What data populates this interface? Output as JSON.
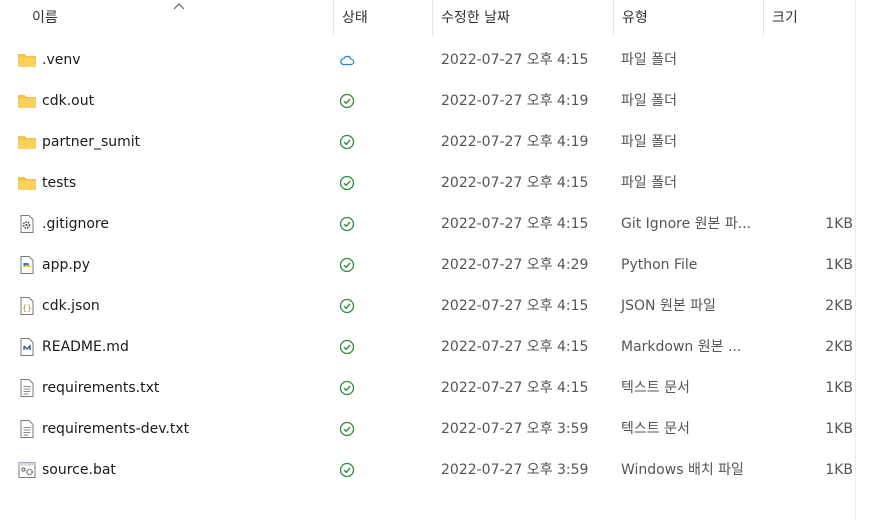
{
  "columns": {
    "name": "이름",
    "status": "상태",
    "date": "수정한 날짜",
    "type": "유형",
    "size": "크기"
  },
  "colors": {
    "folder": "#f8c543",
    "synced": "#2e8b3f",
    "cloud": "#2d7fd4"
  },
  "rows": [
    {
      "name": ".venv",
      "icon": "folder-icon",
      "status": "cloud-icon",
      "date": "2022-07-27 오후 4:15",
      "type": "파일 폴더",
      "size": ""
    },
    {
      "name": "cdk.out",
      "icon": "folder-icon",
      "status": "synced-check-icon",
      "date": "2022-07-27 오후 4:19",
      "type": "파일 폴더",
      "size": ""
    },
    {
      "name": "partner_sumit",
      "icon": "folder-icon",
      "status": "synced-check-icon",
      "date": "2022-07-27 오후 4:19",
      "type": "파일 폴더",
      "size": ""
    },
    {
      "name": "tests",
      "icon": "folder-icon",
      "status": "synced-check-icon",
      "date": "2022-07-27 오후 4:15",
      "type": "파일 폴더",
      "size": ""
    },
    {
      "name": ".gitignore",
      "icon": "gear-file-icon",
      "status": "synced-check-icon",
      "date": "2022-07-27 오후 4:15",
      "type": "Git Ignore 원본 파...",
      "size": "1KB"
    },
    {
      "name": "app.py",
      "icon": "python-file-icon",
      "status": "synced-check-icon",
      "date": "2022-07-27 오후 4:29",
      "type": "Python File",
      "size": "1KB"
    },
    {
      "name": "cdk.json",
      "icon": "json-file-icon",
      "status": "synced-check-icon",
      "date": "2022-07-27 오후 4:15",
      "type": "JSON 원본 파일",
      "size": "2KB"
    },
    {
      "name": "README.md",
      "icon": "markdown-file-icon",
      "status": "synced-check-icon",
      "date": "2022-07-27 오후 4:15",
      "type": "Markdown 원본 ...",
      "size": "2KB"
    },
    {
      "name": "requirements.txt",
      "icon": "text-file-icon",
      "status": "synced-check-icon",
      "date": "2022-07-27 오후 4:15",
      "type": "텍스트 문서",
      "size": "1KB"
    },
    {
      "name": "requirements-dev.txt",
      "icon": "text-file-icon",
      "status": "synced-check-icon",
      "date": "2022-07-27 오후 3:59",
      "type": "텍스트 문서",
      "size": "1KB"
    },
    {
      "name": "source.bat",
      "icon": "batch-file-icon",
      "status": "synced-check-icon",
      "date": "2022-07-27 오후 3:59",
      "type": "Windows 배치 파일",
      "size": "1KB"
    }
  ]
}
